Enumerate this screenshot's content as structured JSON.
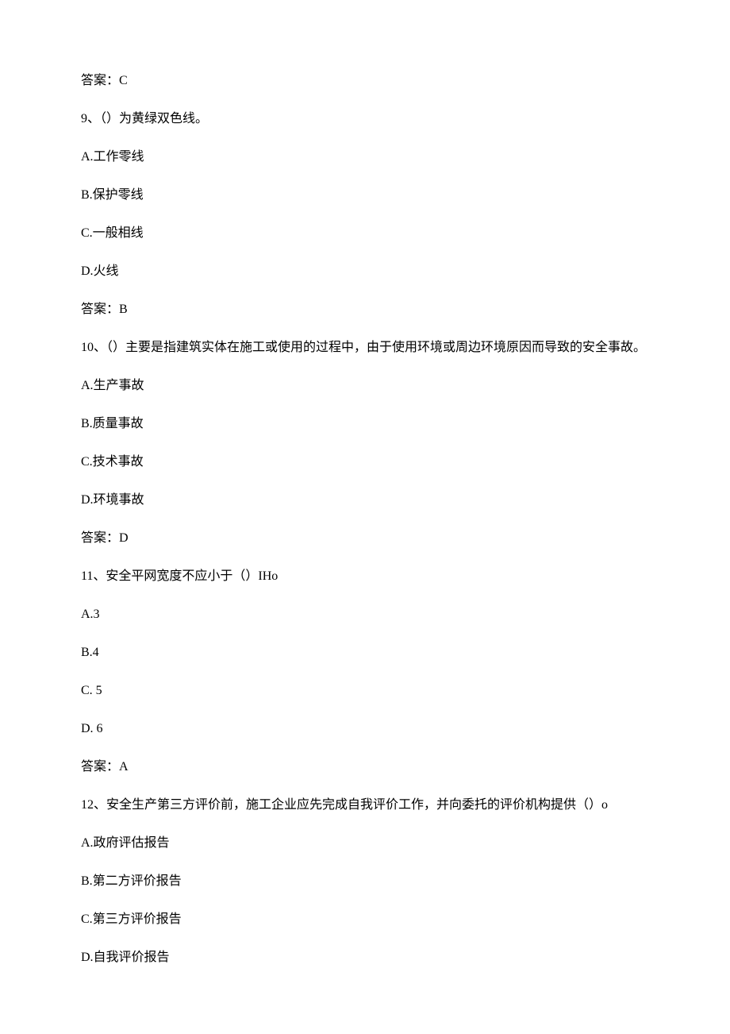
{
  "lines": {
    "l0": "答案：C",
    "l1": "9、（）为黄绿双色线。",
    "l2": "A.工作零线",
    "l3": "B.保护零线",
    "l4": "C.一般相线",
    "l5": "D.火线",
    "l6": "答案：B",
    "l7": "10、（）主要是指建筑实体在施工或使用的过程中，由于使用环境或周边环境原因而导致的安全事故。",
    "l8": "A.生产事故",
    "l9": "B.质量事故",
    "l10": "C.技术事故",
    "l11": "D.环境事故",
    "l12": "答案：D",
    "l13": "11、安全平网宽度不应小于（）IHo",
    "l14": "A.3",
    "l15": "B.4",
    "l16": "C. 5",
    "l17": "D. 6",
    "l18": "答案：A",
    "l19": "12、安全生产第三方评价前，施工企业应先完成自我评价工作，并向委托的评价机构提供（）o",
    "l20": "A.政府评估报告",
    "l21": "B.第二方评价报告",
    "l22": "C.第三方评价报告",
    "l23": "D.自我评价报告"
  }
}
